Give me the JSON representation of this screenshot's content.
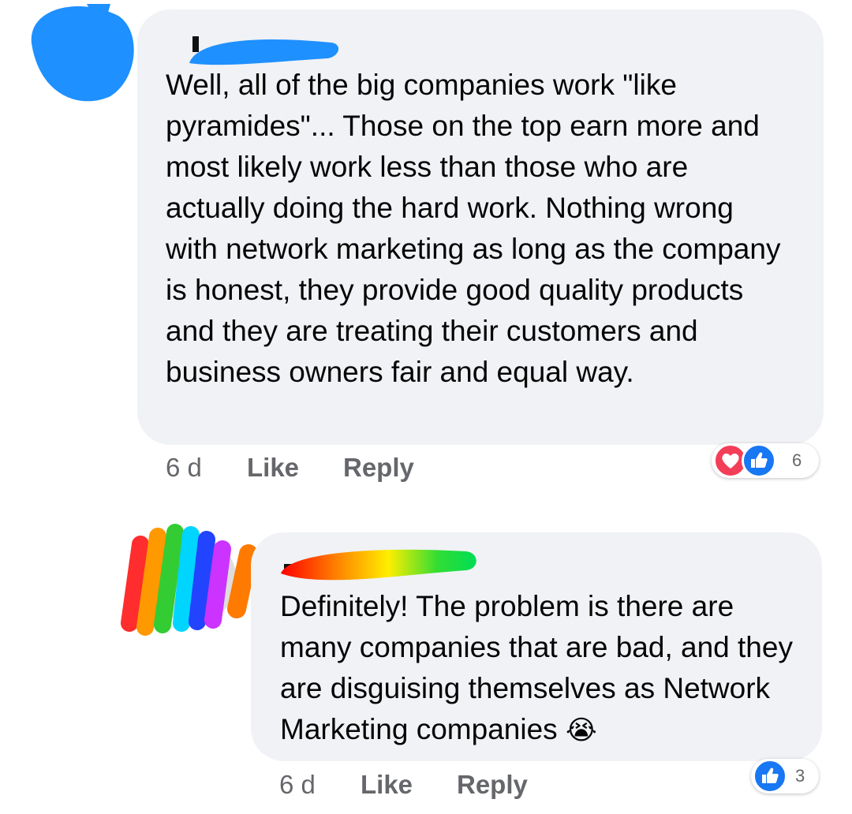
{
  "comments": [
    {
      "author_name": "",
      "body": "Well, all of the big companies work \"like pyramides\"... Those on the top earn more and most likely work less than those who are actually doing the hard work. Nothing wrong with network marketing as long as the company is honest, they provide good quality products and they are treating their customers and business owners fair and equal way.",
      "age": "6 d",
      "like_label": "Like",
      "reply_label": "Reply",
      "reactions": [
        "love-reaction-icon",
        "like-reaction-icon"
      ],
      "reaction_count": "6"
    },
    {
      "author_name": "",
      "body": "Definitely! The problem is there are many companies that are bad, and they are disguising themselves as Network Marketing companies",
      "emoji": "😭",
      "age": "6 d",
      "like_label": "Like",
      "reply_label": "Reply",
      "reactions": [
        "like-reaction-icon"
      ],
      "reaction_count": "3"
    }
  ],
  "colors": {
    "bubble": "#f0f2f5",
    "meta_text": "#65676b",
    "love": "#f33e58",
    "like": "#1877f2",
    "redaction_blue": "#1e90ff"
  }
}
